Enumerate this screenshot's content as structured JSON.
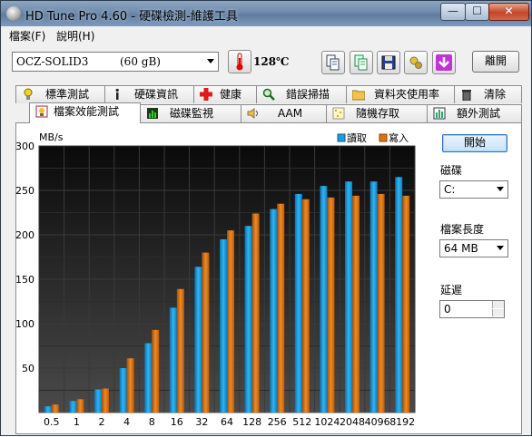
{
  "titlebar": {
    "title": "HD Tune Pro 4.60 - 硬碟檢測-維護工具",
    "minimize": "—",
    "maximize": "☐",
    "close": "✕"
  },
  "menu": {
    "items": [
      "檔案(F)",
      "說明(H)"
    ]
  },
  "toolbar": {
    "drive_name": "OCZ-SOLID3",
    "drive_size": "(60 gB)",
    "temperature": "128℃",
    "icons": [
      "copy-icon",
      "copy-text-icon",
      "save-icon",
      "screenshot-icon",
      "download-icon"
    ],
    "exit_label": "離開"
  },
  "tabs": {
    "row1": [
      {
        "label": "標準測試",
        "icon": "lightbulb-icon"
      },
      {
        "label": "硬碟資訊",
        "icon": "info-icon"
      },
      {
        "label": "健康",
        "icon": "health-cross-icon"
      },
      {
        "label": "錯誤掃描",
        "icon": "magnifier-icon"
      },
      {
        "label": "資料夾使用率",
        "icon": "folder-icon"
      },
      {
        "label": "清除",
        "icon": "trash-icon"
      }
    ],
    "row2": [
      {
        "label": "檔案效能測試",
        "icon": "file-benchmark-icon",
        "active": true
      },
      {
        "label": "磁碟監視",
        "icon": "disk-monitor-icon"
      },
      {
        "label": "AAM",
        "icon": "speaker-icon"
      },
      {
        "label": "隨機存取",
        "icon": "random-access-icon"
      },
      {
        "label": "額外測試",
        "icon": "extra-tests-icon"
      }
    ]
  },
  "chart_data": {
    "type": "bar",
    "ylabel": "MB/s",
    "ylim": [
      0,
      300
    ],
    "yticks": [
      50,
      100,
      150,
      200,
      250,
      300
    ],
    "categories": [
      "0.5",
      "1",
      "2",
      "4",
      "8",
      "16",
      "32",
      "64",
      "128",
      "256",
      "512",
      "1024",
      "2048",
      "4096",
      "8192"
    ],
    "series": [
      {
        "name": "讀取",
        "color": "#1e9ce0",
        "values": [
          7,
          13,
          26,
          50,
          78,
          118,
          164,
          195,
          210,
          229,
          246,
          255,
          260,
          260,
          265
        ]
      },
      {
        "name": "寫入",
        "color": "#e0720e",
        "values": [
          9,
          15,
          27,
          61,
          93,
          139,
          180,
          205,
          224,
          235,
          240,
          242,
          244,
          246,
          244
        ]
      }
    ],
    "grid": true,
    "legend": "top-right"
  },
  "side": {
    "start_label": "開始",
    "disk_label": "磁碟",
    "disk_value": "C:",
    "filesize_label": "檔案長度",
    "filesize_value": "64 MB",
    "delay_label": "延遲",
    "delay_value": "0"
  }
}
